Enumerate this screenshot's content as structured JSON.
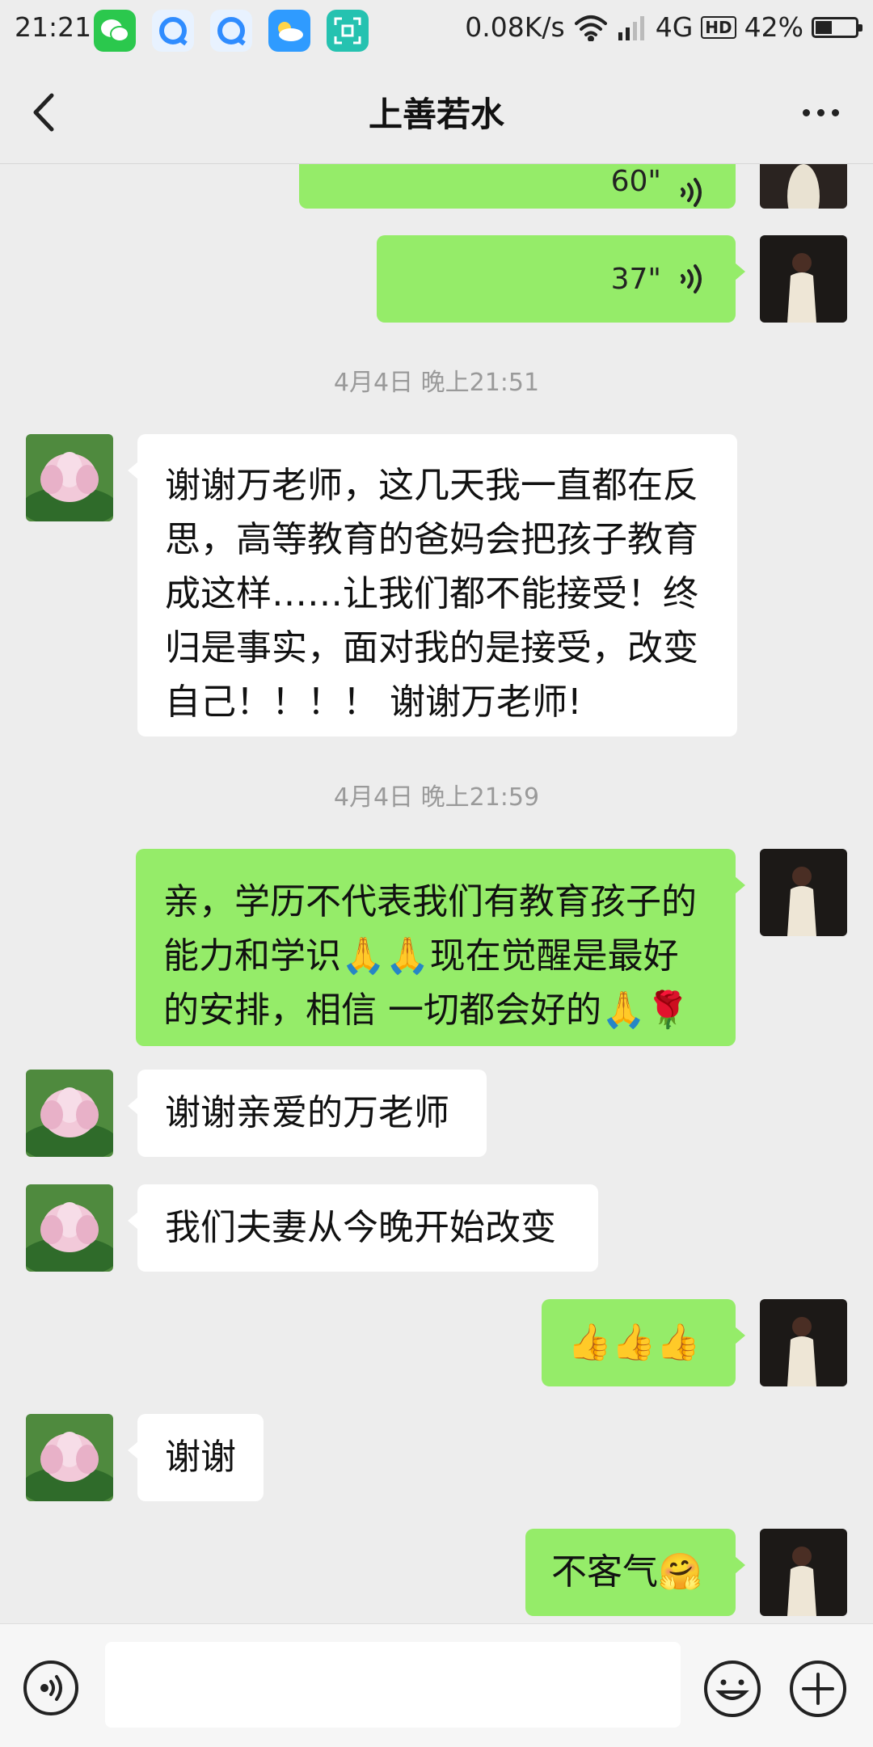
{
  "status_bar": {
    "time": "21:21",
    "network_speed": "0.08K/s",
    "network_type": "4G",
    "hd_badge": "HD",
    "battery": "42%",
    "battery_level": 0.42,
    "app_icons": [
      "wechat-icon",
      "browser-icon",
      "browser-icon",
      "weather-icon",
      "scanner-icon"
    ]
  },
  "header": {
    "title": "上善若水"
  },
  "messages": [
    {
      "type": "voice",
      "side": "right",
      "duration": "60\""
    },
    {
      "type": "voice",
      "side": "right",
      "duration": "37\""
    },
    {
      "type": "time",
      "text": "4月4日 晚上21:51"
    },
    {
      "type": "text",
      "side": "left",
      "lines": [
        "谢谢万老师，这几天我一直都在反",
        "思，高等教育的爸妈会把孩子教育",
        "成这样……让我们都不能接受！终",
        "归是事实，面对我的是接受，改变",
        "自己！！！！ 谢谢万老师!"
      ]
    },
    {
      "type": "time",
      "text": "4月4日 晚上21:59"
    },
    {
      "type": "text",
      "side": "right",
      "lines": [
        "亲，学历不代表我们有教育孩子的",
        "能力和学识🙏🙏现在觉醒是最好",
        "的安排，相信 一切都会好的🙏🌹"
      ]
    },
    {
      "type": "text",
      "side": "left",
      "lines": [
        "谢谢亲爱的万老师"
      ]
    },
    {
      "type": "text",
      "side": "left",
      "lines": [
        "我们夫妻从今晚开始改变"
      ]
    },
    {
      "type": "text",
      "side": "right",
      "lines": [
        "👍👍👍"
      ]
    },
    {
      "type": "text",
      "side": "left",
      "lines": [
        "谢谢"
      ]
    },
    {
      "type": "text",
      "side": "right",
      "lines": [
        "不客气🤗"
      ]
    }
  ],
  "colors": {
    "background": "#ededed",
    "bubble_sent": "#95ec69",
    "bubble_received": "#ffffff",
    "timestamp": "#9a9a9a"
  },
  "icons": {
    "back": "chevron-left-icon",
    "more": "more-dots-icon",
    "voice_input": "voice-input-icon",
    "emoji": "emoji-icon",
    "plus": "plus-icon"
  }
}
